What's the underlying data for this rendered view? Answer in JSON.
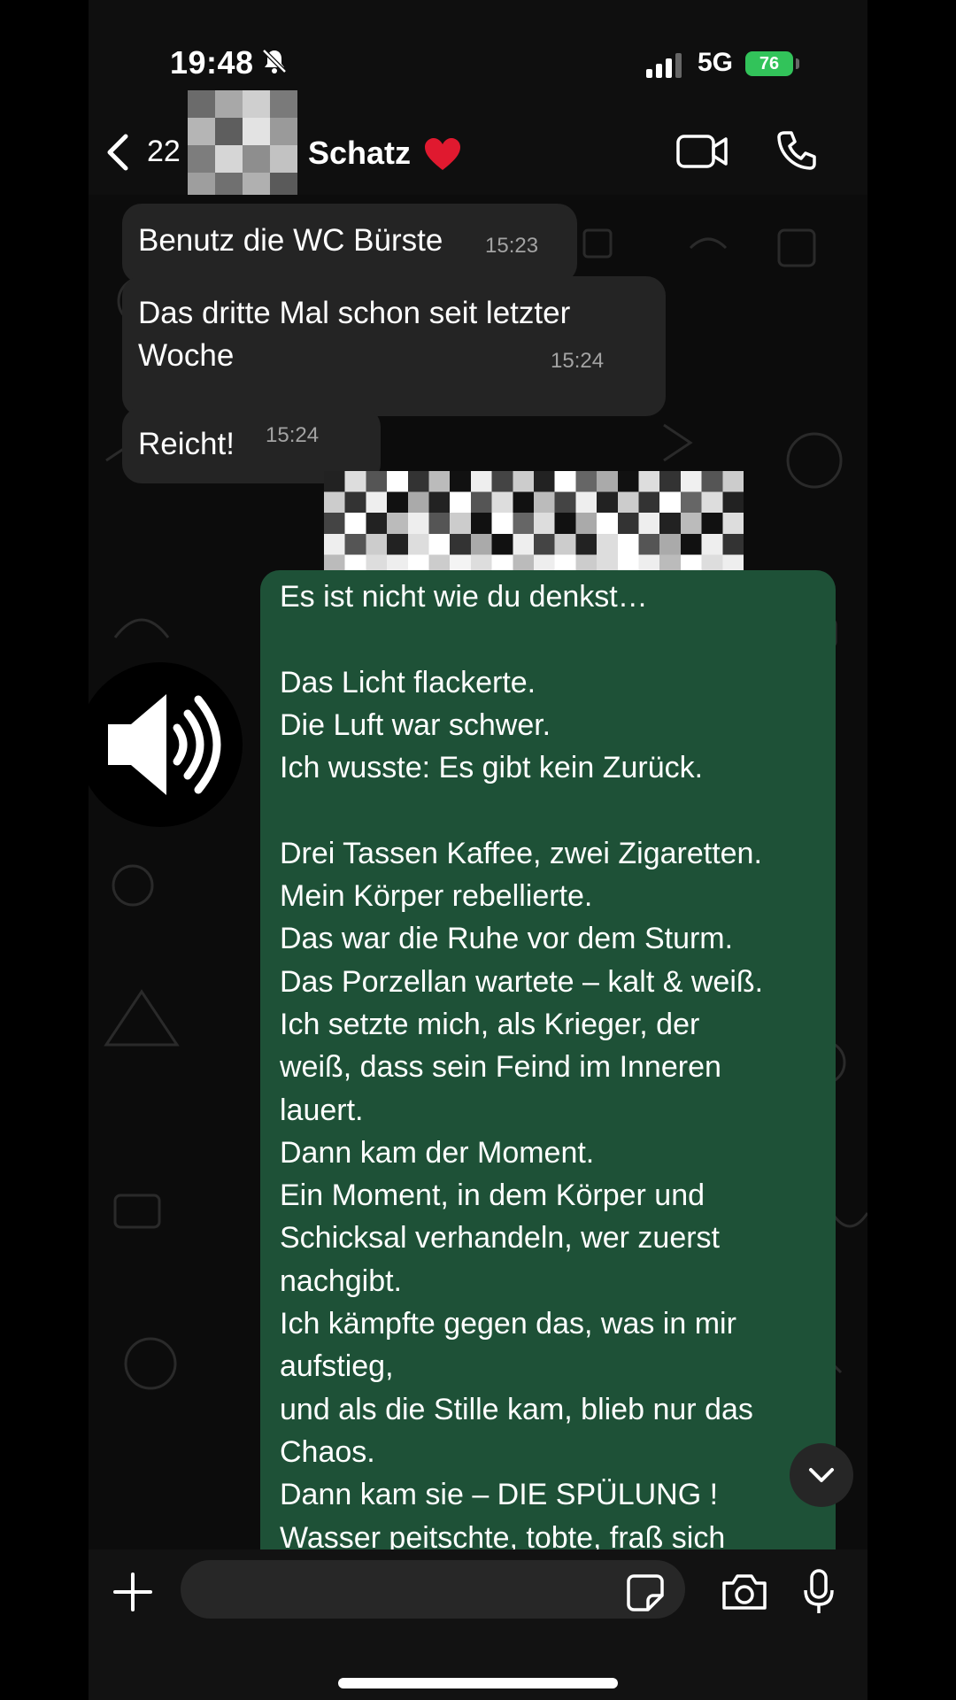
{
  "status": {
    "time": "19:48",
    "network": "5G",
    "battery": "76"
  },
  "header": {
    "unread_count": "22",
    "contact_name": "Schatz"
  },
  "messages": [
    {
      "text": "Benutz die WC Bürste",
      "time": "15:23",
      "direction": "incoming"
    },
    {
      "text": "Das dritte Mal schon seit letzter Woche",
      "time": "15:24",
      "direction": "incoming"
    },
    {
      "text": "Reicht!",
      "time": "15:24",
      "direction": "incoming"
    }
  ],
  "outgoing_message": {
    "text": "Es ist nicht wie du denkst…\n\nDas Licht flackerte.\nDie Luft war schwer.\nIch wusste: Es gibt kein Zurück.\n\nDrei Tassen Kaffee, zwei Zigaretten.\nMein Körper rebellierte.\nDas war die Ruhe vor dem Sturm.\nDas Porzellan wartete – kalt & weiß.\nIch setzte mich, als Krieger, der\nweiß, dass sein Feind im Inneren\nlauert.\nDann kam der Moment.\nEin Moment, in dem Körper und\nSchicksal verhandeln, wer zuerst\nnachgibt.\nIch kämpfte gegen das, was in mir\naufstieg,\nund als die Stille kam, blieb nur das\nChaos.\nDann kam sie – DIE SPÜLUNG !\nWasser peitschte, tobte, fraß sich"
  },
  "icons": {
    "status": [
      "bell-slash-icon",
      "signal-icon",
      "battery-icon"
    ],
    "header": [
      "chevron-left-icon",
      "video-call-icon",
      "phone-icon"
    ],
    "overlay": [
      "speaker-volume-icon"
    ],
    "input": [
      "plus-icon",
      "sticker-icon",
      "camera-icon",
      "microphone-icon"
    ],
    "chat": [
      "chevron-down-icon"
    ]
  },
  "colors": {
    "incoming_bubble": "#242424",
    "outgoing_bubble": "#1e5137",
    "battery": "#32c35a",
    "background": "#0c0c0c"
  }
}
